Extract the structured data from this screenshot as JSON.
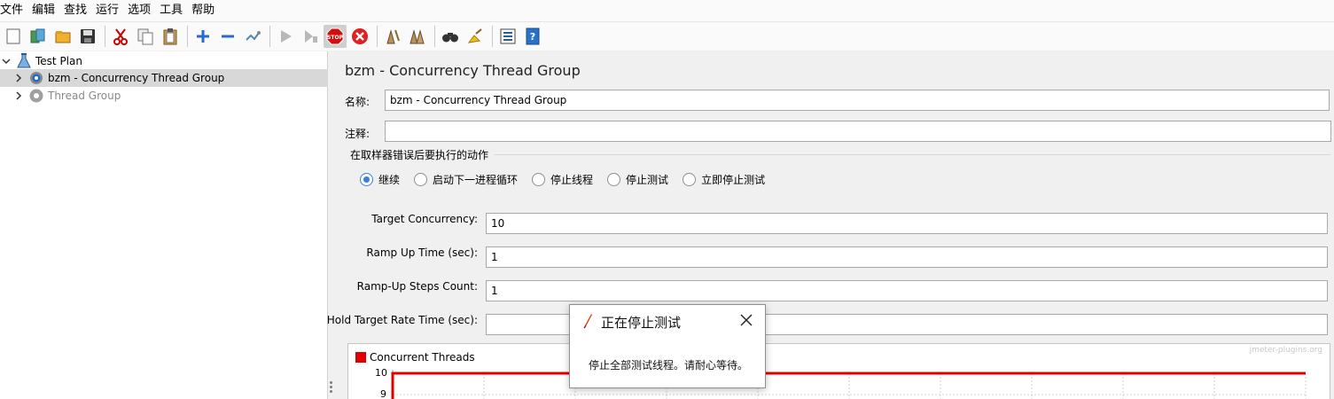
{
  "menu": [
    "文件",
    "编辑",
    "查找",
    "运行",
    "选项",
    "工具",
    "帮助"
  ],
  "toolbar": {
    "groups": [
      [
        "new-icon",
        "templates-icon",
        "open-icon",
        "save-icon"
      ],
      [
        "cut-icon",
        "copy-icon",
        "paste-icon"
      ],
      [
        "add-icon",
        "remove-icon",
        "toggle-icon"
      ],
      [
        "start-icon",
        "start-no-pause-icon",
        "stop-icon",
        "shutdown-icon"
      ],
      [
        "clear-icon",
        "clear-all-icon"
      ],
      [
        "search-icon",
        "reset-search-icon"
      ],
      [
        "function-helper-icon",
        "help-icon"
      ]
    ]
  },
  "tree": {
    "items": [
      {
        "label": "Test Plan",
        "expanded": true,
        "disabled": false,
        "selected": false
      },
      {
        "label": "bzm - Concurrency Thread Group",
        "expanded": false,
        "disabled": false,
        "selected": true
      },
      {
        "label": "Thread Group",
        "expanded": false,
        "disabled": true,
        "selected": false
      }
    ]
  },
  "panel": {
    "title": "bzm - Concurrency Thread Group",
    "name_label": "名称:",
    "name_value": "bzm - Concurrency Thread Group",
    "comment_label": "注释:",
    "comment_value": "",
    "error_action_title": "在取样器错误后要执行的动作",
    "error_actions": [
      "继续",
      "启动下一进程循环",
      "停止线程",
      "停止测试",
      "立即停止测试"
    ],
    "error_action_selected": "继续",
    "target_concurrency_label": "Target Concurrency:",
    "target_concurrency_value": "10",
    "ramp_up_label": "Ramp Up Time (sec):",
    "ramp_up_value": "1",
    "ramp_steps_label": "Ramp-Up Steps Count:",
    "ramp_steps_value": "1",
    "hold_label": "Hold Target Rate Time (sec):",
    "hold_value": ""
  },
  "chart_data": {
    "type": "line",
    "title": "",
    "legend": [
      "Concurrent Threads"
    ],
    "watermark": "jmeter-plugins.org",
    "y_ticks": [
      "10",
      "9"
    ],
    "series": [
      {
        "name": "Concurrent Threads",
        "color": "#e00000",
        "values": [
          10,
          10
        ]
      }
    ]
  },
  "dialog": {
    "title": "正在停止测试",
    "message": "停止全部测试线程。请耐心等待。"
  }
}
